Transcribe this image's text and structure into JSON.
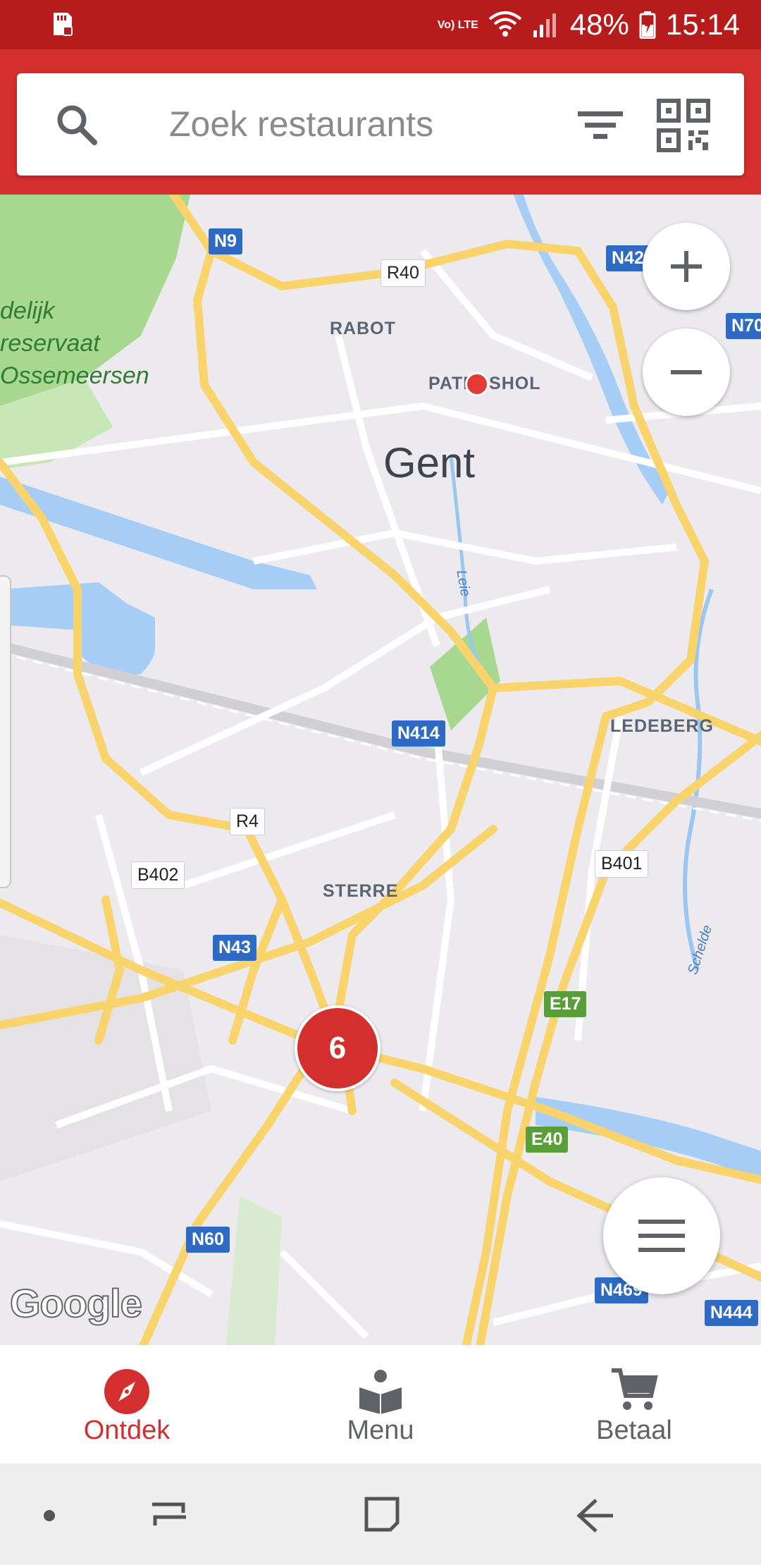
{
  "status_bar": {
    "network": "Vo) LTE",
    "battery": "48%",
    "time": "15:14"
  },
  "search": {
    "placeholder": "Zoek restaurants"
  },
  "map": {
    "city": "Gent",
    "districts": [
      "RABOT",
      "PATERSHOL",
      "LEDEBERG",
      "STERRE"
    ],
    "park_label": [
      "delijk",
      "reservaat",
      "Ossemeersen"
    ],
    "rivers": [
      "Leie",
      "Schelde"
    ],
    "road_shields": {
      "n9": "N9",
      "r40": "R40",
      "n424": "N424",
      "n70": "N70",
      "n414": "N414",
      "r4": "R4",
      "b402": "B402",
      "b401": "B401",
      "n43": "N43",
      "e17": "E17",
      "e40": "E40",
      "n60": "N60",
      "n469": "N469",
      "n444": "N444"
    },
    "cluster_count": "6",
    "attribution": "Google"
  },
  "bottom_nav": {
    "items": [
      {
        "label": "Ontdek",
        "active": true,
        "icon": "compass-icon"
      },
      {
        "label": "Menu",
        "active": false,
        "icon": "book-icon"
      },
      {
        "label": "Betaal",
        "active": false,
        "icon": "cart-icon"
      }
    ]
  },
  "colors": {
    "primary": "#d32f2f",
    "status_bar": "#b71c1c",
    "road": "#f9d36b",
    "water": "#a6cdf5",
    "park": "#a8d88f"
  }
}
